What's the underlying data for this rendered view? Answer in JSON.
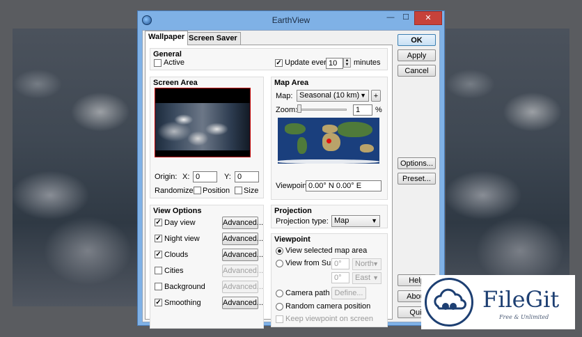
{
  "window": {
    "title": "EarthView",
    "min_glyph": "—",
    "max_glyph": "☐",
    "close_glyph": "✕"
  },
  "tabs": [
    {
      "label": "Wallpaper"
    },
    {
      "label": "Screen Saver"
    }
  ],
  "general": {
    "title": "General",
    "active_label": "Active",
    "active_checked": false,
    "update_label": "Update every",
    "update_checked": true,
    "update_value": "10",
    "update_unit": "minutes"
  },
  "screen_area": {
    "title": "Screen Area",
    "origin_label": "Origin:",
    "x_label": "X:",
    "x_value": "0",
    "y_label": "Y:",
    "y_value": "0",
    "randomize_label": "Randomize:",
    "position_label": "Position",
    "size_label": "Size"
  },
  "map_area": {
    "title": "Map Area",
    "map_label": "Map:",
    "map_value": "Seasonal (10 km)",
    "plus_label": "+",
    "zoom_label": "Zoom:",
    "zoom_value": "1",
    "zoom_unit": "%",
    "viewpoint_label": "Viewpoint:",
    "viewpoint_value": "0.00° N   0.00° E"
  },
  "view_options": {
    "title": "View Options",
    "items": [
      {
        "label": "Day view",
        "checked": true,
        "button": "Advanced...",
        "enabled": true
      },
      {
        "label": "Night view",
        "checked": true,
        "button": "Advanced...",
        "enabled": true
      },
      {
        "label": "Clouds",
        "checked": true,
        "button": "Advanced...",
        "enabled": true
      },
      {
        "label": "Cities",
        "checked": false,
        "button": "Advanced...",
        "enabled": false
      },
      {
        "label": "Background",
        "checked": false,
        "button": "Advanced...",
        "enabled": false
      },
      {
        "label": "Smoothing",
        "checked": true,
        "button": "Advanced...",
        "enabled": true
      }
    ]
  },
  "projection": {
    "title": "Projection",
    "type_label": "Projection type:",
    "type_value": "Map"
  },
  "viewpoint": {
    "title": "Viewpoint",
    "view_selected": "View selected map area",
    "view_from_sun": "View from Sun +",
    "sun_deg1": "0°",
    "sun_dir1": "North",
    "sun_deg2": "0°",
    "sun_dir2": "East",
    "camera_path": "Camera path",
    "define_label": "Define...",
    "random_camera": "Random camera position",
    "keep_viewpoint": "Keep viewpoint on screen"
  },
  "side_buttons": {
    "ok": "OK",
    "apply": "Apply",
    "cancel": "Cancel",
    "options": "Options...",
    "preset": "Preset...",
    "help": "Help",
    "about": "About",
    "quit": "Quit"
  },
  "watermark": {
    "title": "FileGit",
    "subtitle": "Free & Unlimited"
  }
}
